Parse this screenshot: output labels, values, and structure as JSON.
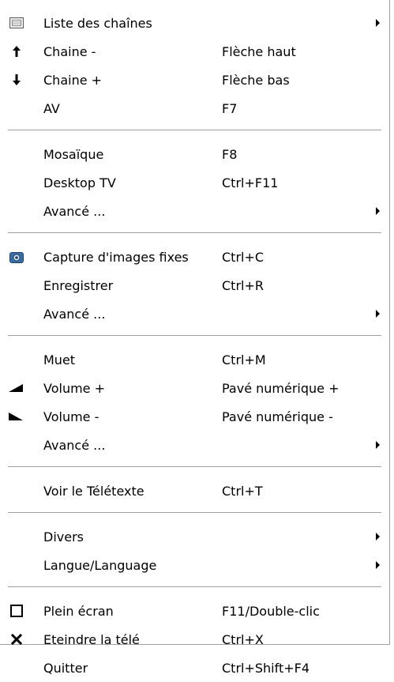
{
  "menu": {
    "groups": [
      {
        "items": [
          {
            "label": "Liste des chaînes",
            "shortcut": "",
            "icon": "channel-list-icon",
            "submenu": true
          },
          {
            "label": "Chaine -",
            "shortcut": "Flèche haut",
            "icon": "arrow-up-icon",
            "submenu": false
          },
          {
            "label": "Chaine +",
            "shortcut": "Flèche bas",
            "icon": "arrow-down-icon",
            "submenu": false
          },
          {
            "label": "AV",
            "shortcut": "F7",
            "icon": "",
            "submenu": false
          }
        ]
      },
      {
        "items": [
          {
            "label": "Mosaïque",
            "shortcut": "F8",
            "icon": "",
            "submenu": false
          },
          {
            "label": "Desktop TV",
            "shortcut": "Ctrl+F11",
            "icon": "",
            "submenu": false
          },
          {
            "label": "Avancé ...",
            "shortcut": "",
            "icon": "",
            "submenu": true
          }
        ]
      },
      {
        "items": [
          {
            "label": "Capture d'images fixes",
            "shortcut": "Ctrl+C",
            "icon": "camera-icon",
            "submenu": false
          },
          {
            "label": "Enregistrer",
            "shortcut": "Ctrl+R",
            "icon": "",
            "submenu": false
          },
          {
            "label": "Avancé ...",
            "shortcut": "",
            "icon": "",
            "submenu": true
          }
        ]
      },
      {
        "items": [
          {
            "label": "Muet",
            "shortcut": "Ctrl+M",
            "icon": "",
            "submenu": false
          },
          {
            "label": "Volume +",
            "shortcut": "Pavé numérique +",
            "icon": "volume-up-icon",
            "submenu": false
          },
          {
            "label": "Volume -",
            "shortcut": "Pavé numérique -",
            "icon": "volume-down-icon",
            "submenu": false
          },
          {
            "label": "Avancé ...",
            "shortcut": "",
            "icon": "",
            "submenu": true
          }
        ]
      },
      {
        "items": [
          {
            "label": "Voir le Télétexte",
            "shortcut": "Ctrl+T",
            "icon": "",
            "submenu": false
          }
        ]
      },
      {
        "items": [
          {
            "label": "Divers",
            "shortcut": "",
            "icon": "",
            "submenu": true
          },
          {
            "label": "Langue/Language",
            "shortcut": "",
            "icon": "",
            "submenu": true
          }
        ]
      },
      {
        "items": [
          {
            "label": "Plein écran",
            "shortcut": "F11/Double-clic",
            "icon": "fullscreen-icon",
            "submenu": false
          },
          {
            "label": "Eteindre la télé",
            "shortcut": "Ctrl+X",
            "icon": "close-icon",
            "submenu": false
          },
          {
            "label": "Quitter",
            "shortcut": "Ctrl+Shift+F4",
            "icon": "",
            "submenu": false
          }
        ]
      }
    ]
  }
}
